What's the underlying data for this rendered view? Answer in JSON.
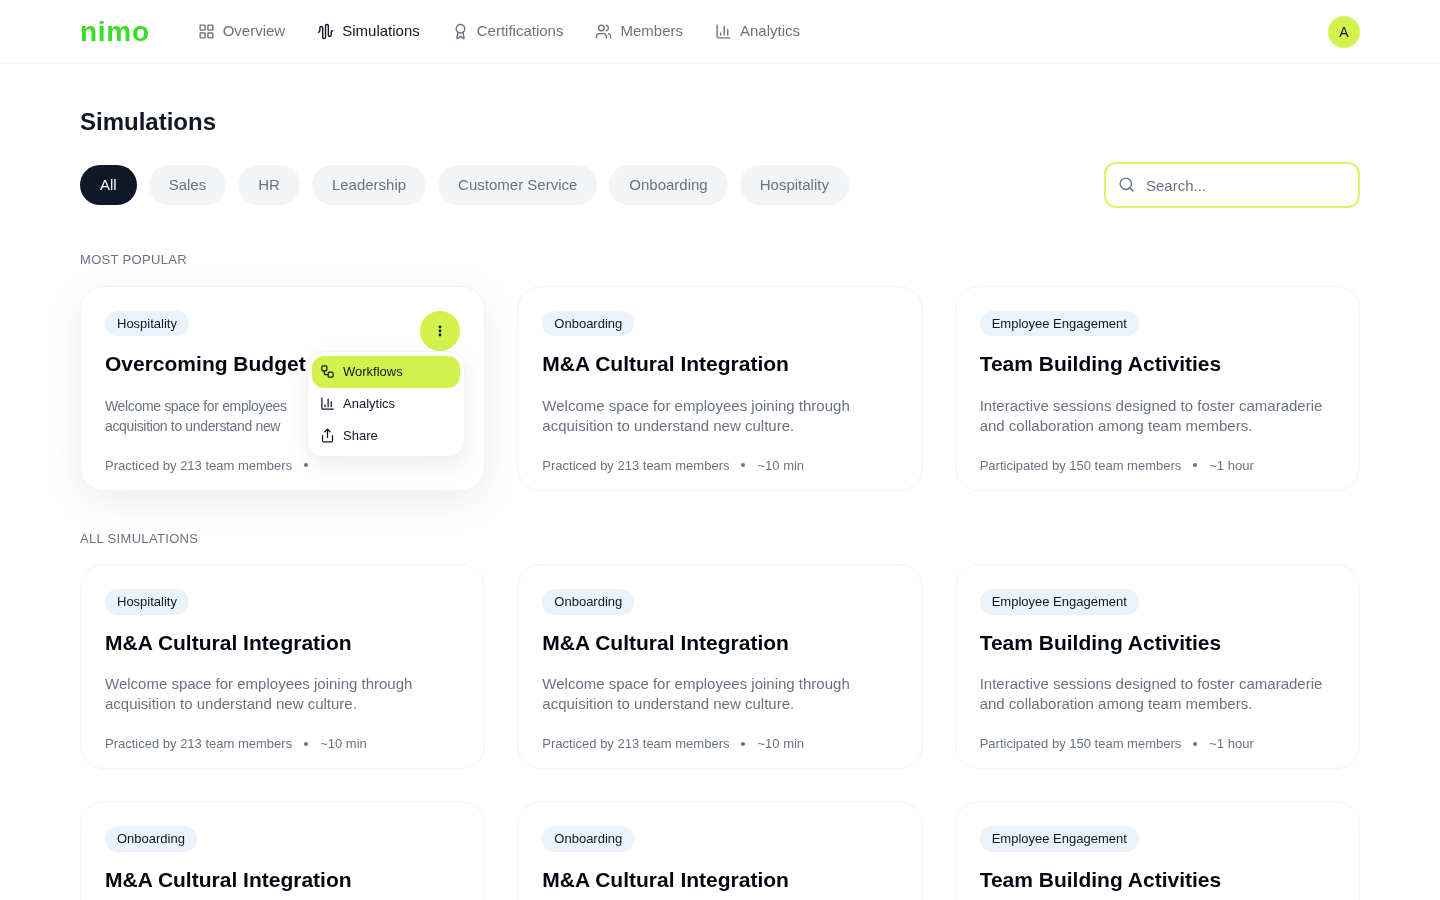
{
  "logo": "nimo",
  "nav": [
    {
      "label": "Overview",
      "selected": false
    },
    {
      "label": "Simulations",
      "selected": true
    },
    {
      "label": "Certifications",
      "selected": false
    },
    {
      "label": "Members",
      "selected": false
    },
    {
      "label": "Analytics",
      "selected": false
    }
  ],
  "avatar": "A",
  "title": "Simulations",
  "filters": [
    {
      "label": "All",
      "selected": true
    },
    {
      "label": "Sales",
      "selected": false
    },
    {
      "label": "HR",
      "selected": false
    },
    {
      "label": "Leadership",
      "selected": false
    },
    {
      "label": "Customer Service",
      "selected": false
    },
    {
      "label": "Onboarding",
      "selected": false
    },
    {
      "label": "Hospitality",
      "selected": false
    }
  ],
  "search": {
    "placeholder": "Search..."
  },
  "sections": [
    {
      "heading": "MOST POPULAR",
      "cards": [
        {
          "tag": "Hospitality",
          "title": "Overcoming Budget",
          "description": "Welcome space for employees acquisition to understand new",
          "members": "Practiced by 213 team members",
          "menu_open": true,
          "menu": [
            {
              "label": "Workflows",
              "selected": true
            },
            {
              "label": "Analytics",
              "selected": false
            },
            {
              "label": "Share",
              "selected": false
            }
          ]
        },
        {
          "tag": "Onboarding",
          "title": "M&A Cultural Integration",
          "description": "Welcome space for employees joining through acquisition to understand new culture.",
          "members": "Practiced by 213 team members",
          "duration": "~10 min",
          "menu_open": false
        },
        {
          "tag": "Employee Engagement",
          "title": "Team Building Activities",
          "description": "Interactive sessions designed to foster camaraderie and collaboration among team members.",
          "members": "Participated by 150 team members",
          "duration": "~1 hour",
          "menu_open": false
        }
      ]
    },
    {
      "heading": "ALL SIMULATIONS",
      "cards": [
        {
          "tag": "Hospitality",
          "title": "M&A Cultural Integration",
          "description": "Welcome space for employees joining through acquisition to understand new culture.",
          "members": "Practiced by 213 team members",
          "duration": "~10 min",
          "menu_open": false
        },
        {
          "tag": "Onboarding",
          "title": "M&A Cultural Integration",
          "description": "Welcome space for employees joining through acquisition to understand new culture.",
          "members": "Practiced by 213 team members",
          "duration": "~10 min",
          "menu_open": false
        },
        {
          "tag": "Employee Engagement",
          "title": "Team Building Activities",
          "description": "Interactive sessions designed to foster camaraderie and collaboration among team members.",
          "members": "Participated by 150 team members",
          "duration": "~1 hour",
          "menu_open": false
        },
        {
          "tag": "Onboarding",
          "title": "M&A Cultural Integration",
          "menu_open": false
        },
        {
          "tag": "Onboarding",
          "title": "M&A Cultural Integration",
          "menu_open": false
        },
        {
          "tag": "Employee Engagement",
          "title": "Team Building Activities",
          "menu_open": false
        }
      ]
    }
  ]
}
